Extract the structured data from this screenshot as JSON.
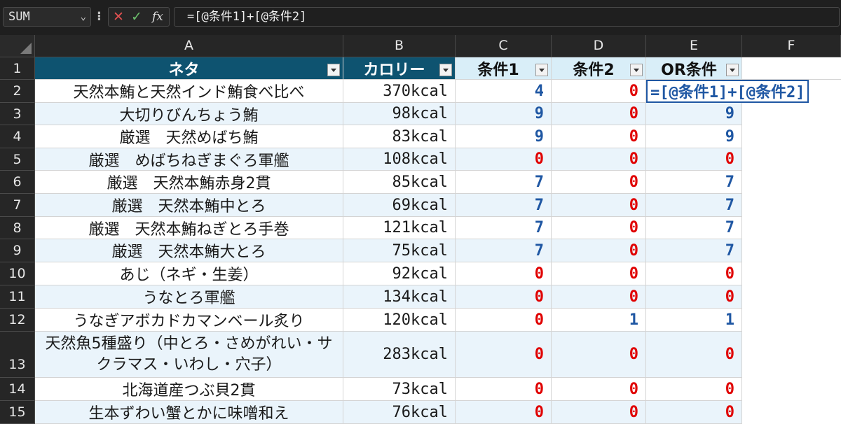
{
  "formula_bar": {
    "name_box": "SUM",
    "separator": "⁝",
    "cancel_icon": "✕",
    "enter_icon": "✓",
    "fx_label": "fx",
    "formula": "=[@条件1]+[@条件2]"
  },
  "columns": [
    "A",
    "B",
    "C",
    "D",
    "E",
    "F"
  ],
  "header": {
    "neta": "ネタ",
    "calorie": "カロリー",
    "cond1": "条件1",
    "cond2": "条件2",
    "or_cond": "OR条件"
  },
  "rows": [
    {
      "num": "2",
      "neta": "天然本鮪と天然インド鮪食べ比べ",
      "cal": "370kcal",
      "c1": "4",
      "c2": "0",
      "or": ""
    },
    {
      "num": "3",
      "neta": "大切りびんちょう鮪",
      "cal": "98kcal",
      "c1": "9",
      "c2": "0",
      "or": "9"
    },
    {
      "num": "4",
      "neta": "厳選　天然めばち鮪",
      "cal": "83kcal",
      "c1": "9",
      "c2": "0",
      "or": "9"
    },
    {
      "num": "5",
      "neta": "厳選　めばちねぎまぐろ軍艦",
      "cal": "108kcal",
      "c1": "0",
      "c2": "0",
      "or": "0"
    },
    {
      "num": "6",
      "neta": "厳選　天然本鮪赤身2貫",
      "cal": "85kcal",
      "c1": "7",
      "c2": "0",
      "or": "7"
    },
    {
      "num": "7",
      "neta": "厳選　天然本鮪中とろ",
      "cal": "69kcal",
      "c1": "7",
      "c2": "0",
      "or": "7"
    },
    {
      "num": "8",
      "neta": "厳選　天然本鮪ねぎとろ手巻",
      "cal": "121kcal",
      "c1": "7",
      "c2": "0",
      "or": "7"
    },
    {
      "num": "9",
      "neta": "厳選　天然本鮪大とろ",
      "cal": "75kcal",
      "c1": "7",
      "c2": "0",
      "or": "7"
    },
    {
      "num": "10",
      "neta": "あじ（ネギ・生姜）",
      "cal": "92kcal",
      "c1": "0",
      "c2": "0",
      "or": "0"
    },
    {
      "num": "11",
      "neta": "うなとろ軍艦",
      "cal": "134kcal",
      "c1": "0",
      "c2": "0",
      "or": "0"
    },
    {
      "num": "12",
      "neta": "うなぎアボカドカマンベール炙り",
      "cal": "120kcal",
      "c1": "0",
      "c2": "1",
      "or": "1"
    },
    {
      "num": "13",
      "neta": "天然魚5種盛り（中とろ・さめがれい・サクラマス・いわし・穴子）",
      "cal": "283kcal",
      "c1": "0",
      "c2": "0",
      "or": "0"
    },
    {
      "num": "14",
      "neta": "北海道産つぶ貝2貫",
      "cal": "73kcal",
      "c1": "0",
      "c2": "0",
      "or": "0"
    },
    {
      "num": "15",
      "neta": "生本ずわい蟹とかに味噌和え",
      "cal": "76kcal",
      "c1": "0",
      "c2": "0",
      "or": "0"
    }
  ],
  "editing_cell": {
    "text": "=[@条件1]+[@条件2]"
  },
  "colors": {
    "header_dark": "#0e5370",
    "header_light": "#d9eef8",
    "stripe": "#eaf4fb",
    "blue": "#1f57a3",
    "red": "#e00000"
  }
}
